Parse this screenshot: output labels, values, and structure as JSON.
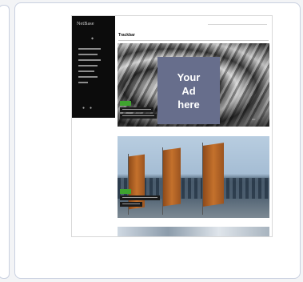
{
  "ad": {
    "line1": "Your",
    "line2": "Ad",
    "line3": "here",
    "color": "#676e8c"
  },
  "preview": {
    "logo_text": "NetBase",
    "page_title": "Trackbar",
    "tag_color": "#3fa32f",
    "sidebar_color": "#0c0c0c"
  }
}
